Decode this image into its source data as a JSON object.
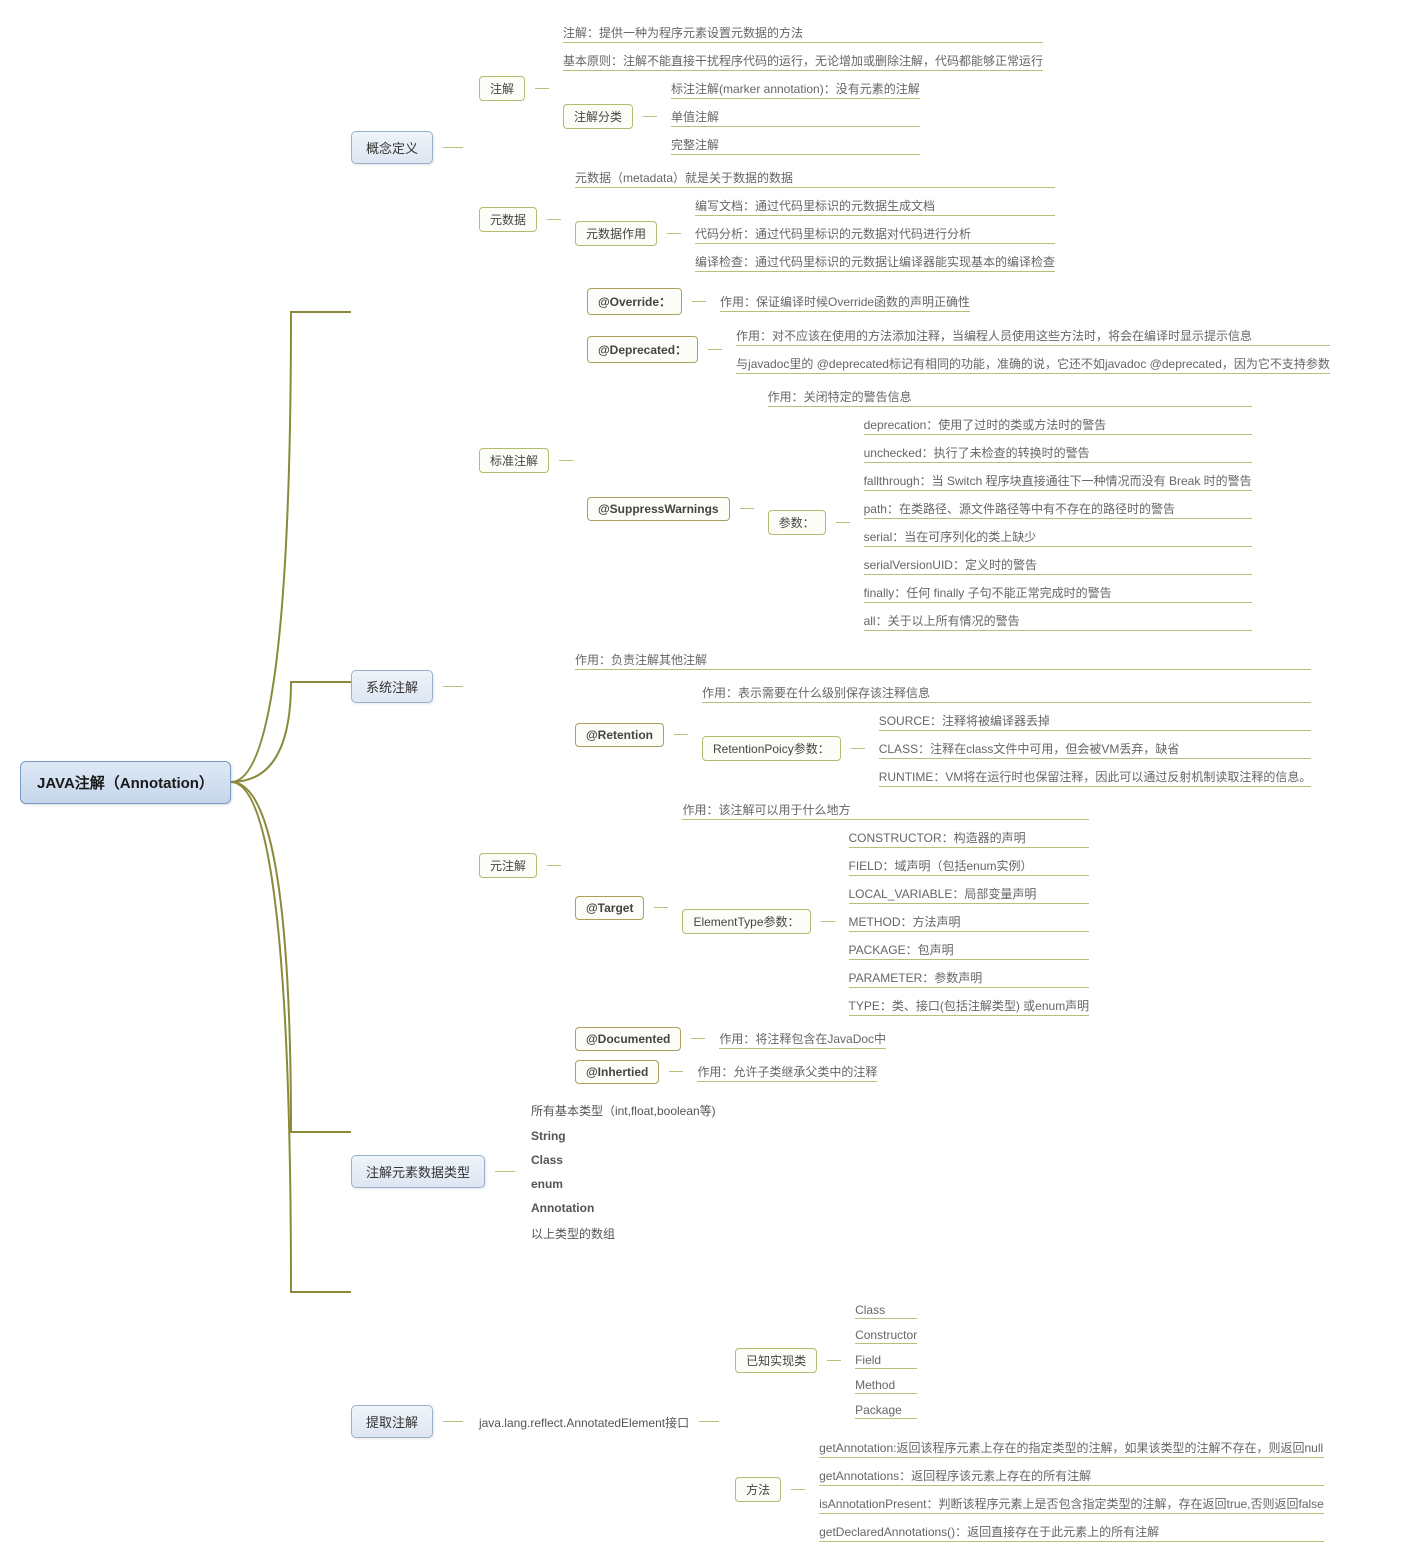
{
  "root": "JAVA注解（Annotation）",
  "b1": {
    "label": "概念定义",
    "annotation": {
      "label": "注解",
      "c1": "注解：提供一种为程序元素设置元数据的方法",
      "c2": "基本原则：注解不能直接干扰程序代码的运行，无论增加或删除注解，代码都能够正常运行",
      "classify": {
        "label": "注解分类",
        "c1": "标注注解(marker annotation)：没有元素的注解",
        "c2": "单值注解",
        "c3": "完整注解"
      }
    },
    "metadata": {
      "label": "元数据",
      "c1": "元数据（metadata）就是关于数据的数据",
      "usage": {
        "label": "元数据作用",
        "c1": "编写文档：通过代码里标识的元数据生成文档",
        "c2": "代码分析：通过代码里标识的元数据对代码进行分析",
        "c3": "编译检查：通过代码里标识的元数据让编译器能实现基本的编译检查"
      }
    }
  },
  "b2": {
    "label": "系统注解",
    "standard": {
      "label": "标准注解",
      "override": {
        "label": "@Override：",
        "c1": "作用：保证编译时候Override函数的声明正确性"
      },
      "deprecated": {
        "label": "@Deprecated：",
        "c1": "作用：对不应该在使用的方法添加注释，当编程人员使用这些方法时，将会在编译时显示提示信息",
        "c2": "与javadoc里的 @deprecated标记有相同的功能，准确的说，它还不如javadoc @deprecated，因为它不支持参数"
      },
      "suppress": {
        "label": "@SuppressWarnings",
        "c1": "作用：关闭特定的警告信息",
        "params": {
          "label": "参数：",
          "p1": "deprecation：使用了过时的类或方法时的警告",
          "p2": "unchecked：执行了未检查的转换时的警告",
          "p3": "fallthrough：当 Switch 程序块直接通往下一种情况而没有 Break 时的警告  ",
          "p4": "path：在类路径、源文件路径等中有不存在的路径时的警告",
          "p5": "serial：当在可序列化的类上缺少",
          "p6": "serialVersionUID：定义时的警告",
          "p7": "finally：任何 finally 子句不能正常完成时的警告",
          "p8": "all：关于以上所有情况的警告"
        }
      }
    },
    "meta": {
      "label": "元注解",
      "c1": "作用：负责注解其他注解",
      "retention": {
        "label": "@Retention",
        "c1": "作用：表示需要在什么级别保存该注释信息",
        "policy": {
          "label": "RetentionPoicy参数：",
          "p1": "SOURCE：注释将被编译器丢掉",
          "p2": "CLASS：注释在class文件中可用，但会被VM丢弃，缺省",
          "p3": "RUNTIME：VM将在运行时也保留注释，因此可以通过反射机制读取注释的信息。"
        }
      },
      "target": {
        "label": "@Target",
        "c1": "作用：该注解可以用于什么地方",
        "element": {
          "label": "ElementType参数：",
          "p1": "CONSTRUCTOR：构造器的声明",
          "p2": "FIELD：域声明（包括enum实例）",
          "p3": "LOCAL_VARIABLE：局部变量声明",
          "p4": "METHOD：方法声明",
          "p5": "PACKAGE：包声明",
          "p6": "PARAMETER：参数声明",
          "p7": "TYPE：类、接口(包括注解类型) 或enum声明"
        }
      },
      "documented": {
        "label": "@Documented",
        "c1": "作用：将注释包含在JavaDoc中"
      },
      "inherited": {
        "label": "@Inhertied",
        "c1": "作用：允许子类继承父类中的注释"
      }
    }
  },
  "b3": {
    "label": "注解元素数据类型",
    "c1": "所有基本类型（int,float,boolean等)",
    "c2": "String",
    "c3": "Class",
    "c4": "enum",
    "c5": "Annotation",
    "c6": "以上类型的数组"
  },
  "b4": {
    "label": "提取注解",
    "iface": "java.lang.reflect.AnnotatedElement接口",
    "impl": {
      "label": "已知实现类",
      "c1": "Class",
      "c2": "Constructor",
      "c3": "Field",
      "c4": "Method",
      "c5": "Package"
    },
    "methods": {
      "label": "方法",
      "m1": "getAnnotation:返回该程序元素上存在的指定类型的注解，如果该类型的注解不存在，则返回null",
      "m2": "getAnnotations：返回程序该元素上存在的所有注解",
      "m3": "isAnnotationPresent：判断该程序元素上是否包含指定类型的注解，存在返回true,否则返回false",
      "m4": "getDeclaredAnnotations()：返回直接存在于此元素上的所有注解"
    }
  }
}
